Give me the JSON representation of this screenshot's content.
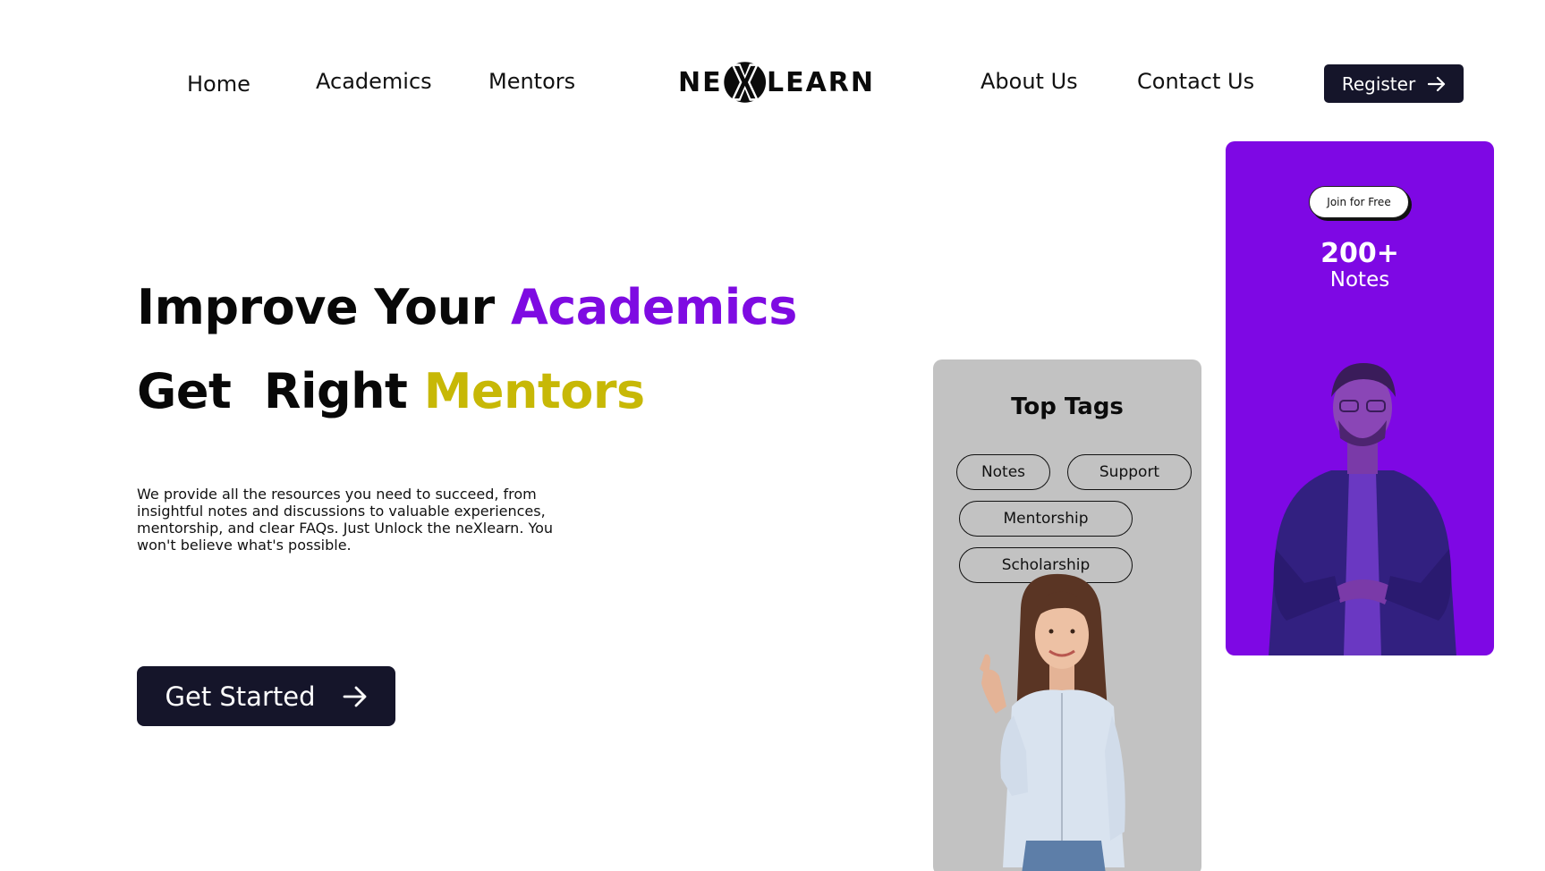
{
  "nav": {
    "left_links": [
      "Home",
      "Academics",
      "Mentors"
    ],
    "right_links": [
      "About Us",
      "Contact Us"
    ],
    "logo": {
      "prefix": "NE",
      "mark": "X",
      "suffix": "LEARN"
    },
    "register_label": "Register"
  },
  "hero": {
    "line1": {
      "part1": "Improve Your",
      "part2": "Academics"
    },
    "line2": {
      "part1": "Get  Right",
      "part2": "Mentors"
    },
    "description": "We provide all the resources you need to succeed, from insightful notes and discussions to valuable experiences, mentorship, and clear FAQs. Just Unlock the neXlearn. You won't believe what's possible.",
    "cta_label": "Get Started"
  },
  "tags_card": {
    "title": "Top Tags",
    "tags": [
      "Notes",
      "Support",
      "Mentorship",
      "Scholarship"
    ]
  },
  "join_card": {
    "join_label": "Join for Free",
    "stat_value": "200+",
    "stat_label": "Notes"
  },
  "colors": {
    "accent_purple": "#7e0be2",
    "accent_olive": "#c7b806",
    "button_dark": "#15152a",
    "card_grey": "#c2c2c2",
    "card_purple": "#7e08e4"
  },
  "icons": {
    "register_arrow": "arrow-right-icon",
    "cta_arrow": "arrow-right-icon"
  }
}
